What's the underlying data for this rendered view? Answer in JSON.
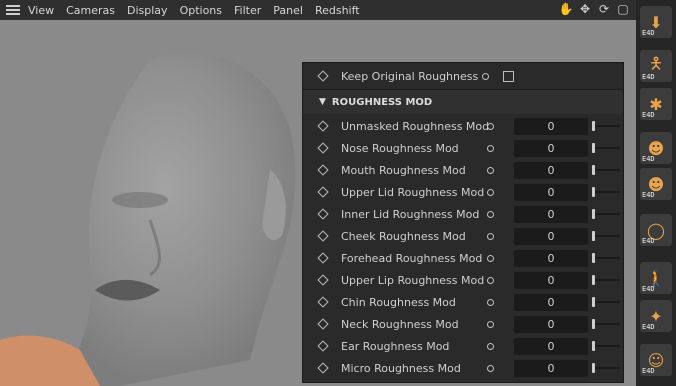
{
  "menubar": {
    "items": [
      "View",
      "Cameras",
      "Display",
      "Options",
      "Filter",
      "Panel",
      "Redshift"
    ],
    "icons": [
      "move-hand-icon",
      "move-arrows-icon",
      "orbit-icon",
      "maximize-icon"
    ]
  },
  "panel": {
    "keep_original": {
      "label": "Keep Original Roughness",
      "checked": false
    },
    "section_title": "ROUGHNESS MOD",
    "rows": [
      {
        "label": "Unmasked Roughness Mod",
        "value": "0"
      },
      {
        "label": "Nose Roughness Mod",
        "value": "0"
      },
      {
        "label": "Mouth Roughness Mod",
        "value": "0"
      },
      {
        "label": "Upper Lid Roughness Mod",
        "value": "0"
      },
      {
        "label": "Inner Lid Roughness Mod",
        "value": "0"
      },
      {
        "label": "Cheek Roughness Mod",
        "value": "0"
      },
      {
        "label": "Forehead Roughness Mod",
        "value": "0"
      },
      {
        "label": "Upper Lip Roughness Mod",
        "value": "0"
      },
      {
        "label": "Chin Roughness Mod",
        "value": "0"
      },
      {
        "label": "Neck Roughness Mod",
        "value": "0"
      },
      {
        "label": "Ear Roughness Mod",
        "value": "0"
      },
      {
        "label": "Micro Roughness Mod",
        "value": "0"
      }
    ]
  },
  "right_toolbar": {
    "tag": "E4D",
    "tools": [
      "download-icon",
      "figure-icon",
      "figure-rig-icon",
      "face-mask-icon",
      "face-orange-icon",
      "ring-icon",
      "walk-icon",
      "pose-icon",
      "face-smile-icon"
    ]
  },
  "colors": {
    "viewport_bg": "#8a8a8a",
    "panel_bg": "#2a2a2a",
    "accent": "#e9a34a"
  }
}
